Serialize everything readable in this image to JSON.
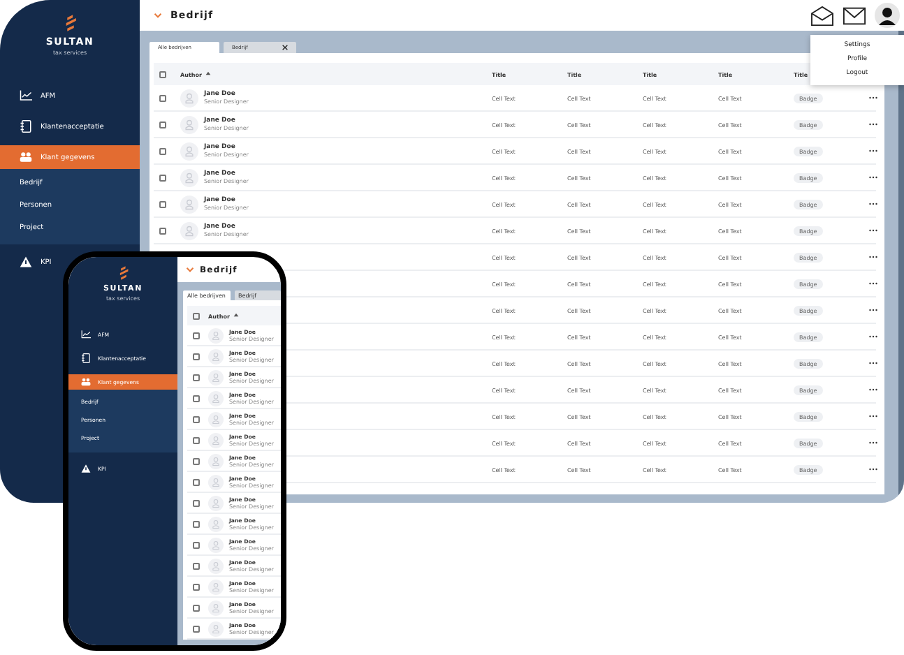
{
  "desktop": {
    "logo": {
      "name": "SULTAN",
      "tagline": "tax services"
    },
    "sidebar": {
      "items": [
        {
          "kind": "chart",
          "label": "AFM",
          "selected": false
        },
        {
          "kind": "book",
          "label": "Klantenacceptatie",
          "selected": false
        },
        {
          "kind": "people",
          "label": "Klant gegevens",
          "selected": true,
          "children": [
            {
              "label": "Bedrijf"
            },
            {
              "label": "Personen"
            },
            {
              "label": "Project"
            }
          ]
        },
        {
          "kind": "warning",
          "label": "KPI",
          "selected": false
        }
      ]
    },
    "header": {
      "title": "Bedrijf"
    },
    "user_menu": {
      "items": [
        "Settings",
        "Profile",
        "Logout"
      ]
    },
    "tabs": [
      {
        "label": "Alle bedrijven",
        "selected": true,
        "closable": false
      },
      {
        "label": "Bedrijf",
        "selected": false,
        "closable": true
      }
    ],
    "table": {
      "select_all_checked": false,
      "author_header": "Author",
      "columns": [
        "Title",
        "Title",
        "Title",
        "Title",
        "Title"
      ],
      "rows": [
        {
          "checked": false,
          "author": {
            "name": "Jane Doe",
            "role": "Senior Designer"
          },
          "cells": [
            "Cell Text",
            "Cell Text",
            "Cell Text",
            "Cell Text"
          ],
          "badge": "Badge"
        },
        {
          "checked": false,
          "author": {
            "name": "Jane Doe",
            "role": "Senior Designer"
          },
          "cells": [
            "Cell Text",
            "Cell Text",
            "Cell Text",
            "Cell Text"
          ],
          "badge": "Badge"
        },
        {
          "checked": false,
          "author": {
            "name": "Jane Doe",
            "role": "Senior Designer"
          },
          "cells": [
            "Cell Text",
            "Cell Text",
            "Cell Text",
            "Cell Text"
          ],
          "badge": "Badge"
        },
        {
          "checked": false,
          "author": {
            "name": "Jane Doe",
            "role": "Senior Designer"
          },
          "cells": [
            "Cell Text",
            "Cell Text",
            "Cell Text",
            "Cell Text"
          ],
          "badge": "Badge"
        },
        {
          "checked": false,
          "author": {
            "name": "Jane Doe",
            "role": "Senior Designer"
          },
          "cells": [
            "Cell Text",
            "Cell Text",
            "Cell Text",
            "Cell Text"
          ],
          "badge": "Badge"
        },
        {
          "checked": false,
          "author": {
            "name": "Jane Doe",
            "role": "Senior Designer"
          },
          "cells": [
            "Cell Text",
            "Cell Text",
            "Cell Text",
            "Cell Text"
          ],
          "badge": "Badge"
        },
        {
          "cells": [
            "Cell Text",
            "Cell Text",
            "Cell Text",
            "Cell Text"
          ],
          "badge": "Badge"
        },
        {
          "cells": [
            "Cell Text",
            "Cell Text",
            "Cell Text",
            "Cell Text"
          ],
          "badge": "Badge"
        },
        {
          "cells": [
            "Cell Text",
            "Cell Text",
            "Cell Text",
            "Cell Text"
          ],
          "badge": "Badge"
        },
        {
          "cells": [
            "Cell Text",
            "Cell Text",
            "Cell Text",
            "Cell Text"
          ],
          "badge": "Badge"
        },
        {
          "cells": [
            "Cell Text",
            "Cell Text",
            "Cell Text",
            "Cell Text"
          ],
          "badge": "Badge"
        },
        {
          "cells": [
            "Cell Text",
            "Cell Text",
            "Cell Text",
            "Cell Text"
          ],
          "badge": "Badge"
        },
        {
          "cells": [
            "Cell Text",
            "Cell Text",
            "Cell Text",
            "Cell Text"
          ],
          "badge": "Badge"
        },
        {
          "cells": [
            "Cell Text",
            "Cell Text",
            "Cell Text",
            "Cell Text"
          ],
          "badge": "Badge"
        },
        {
          "cells": [
            "Cell Text",
            "Cell Text",
            "Cell Text",
            "Cell Text"
          ],
          "badge": "Badge"
        }
      ]
    }
  },
  "mobile": {
    "logo": {
      "name": "SULTAN",
      "tagline": "tax services"
    },
    "sidebar": {
      "items": [
        {
          "kind": "chart",
          "label": "AFM",
          "selected": false
        },
        {
          "kind": "book",
          "label": "Klantenacceptatie",
          "selected": false
        },
        {
          "kind": "people",
          "label": "Klant gegevens",
          "selected": true,
          "children": [
            {
              "label": "Bedrijf"
            },
            {
              "label": "Personen"
            },
            {
              "label": "Project"
            }
          ]
        },
        {
          "kind": "warning",
          "label": "KPI",
          "selected": false
        }
      ]
    },
    "header": {
      "title": "Bedrijf"
    },
    "tabs": [
      {
        "label": "Alle bedrijven",
        "selected": true,
        "closable": false
      },
      {
        "label": "Bedrijf",
        "selected": false,
        "closable": false
      }
    ],
    "table": {
      "select_all_checked": false,
      "author_header": "Author",
      "rows": [
        {
          "checked": false,
          "author": "Jane Doe",
          "role": "Senior Designer"
        },
        {
          "checked": false,
          "author": "Jane Doe",
          "role": "Senior Designer"
        },
        {
          "checked": false,
          "author": "Jane Doe",
          "role": "Senior Designer"
        },
        {
          "checked": false,
          "author": "Jane Doe",
          "role": "Senior Designer"
        },
        {
          "checked": false,
          "author": "Jane Doe",
          "role": "Senior Designer"
        },
        {
          "checked": false,
          "author": "Jane Doe",
          "role": "Senior Designer"
        },
        {
          "checked": false,
          "author": "Jane Doe",
          "role": "Senior Designer"
        },
        {
          "checked": false,
          "author": "Jane Doe",
          "role": "Senior Designer"
        },
        {
          "checked": false,
          "author": "Jane Doe",
          "role": "Senior Designer"
        },
        {
          "checked": false,
          "author": "Jane Doe",
          "role": "Senior Designer"
        },
        {
          "checked": false,
          "author": "Jane Doe",
          "role": "Senior Designer"
        },
        {
          "checked": false,
          "author": "Jane Doe",
          "role": "Senior Designer"
        },
        {
          "checked": false,
          "author": "Jane Doe",
          "role": "Senior Designer"
        },
        {
          "checked": false,
          "author": "Jane Doe",
          "role": "Senior Designer"
        },
        {
          "checked": false,
          "author": "Jane Doe",
          "role": "Senior Designer"
        }
      ]
    }
  }
}
